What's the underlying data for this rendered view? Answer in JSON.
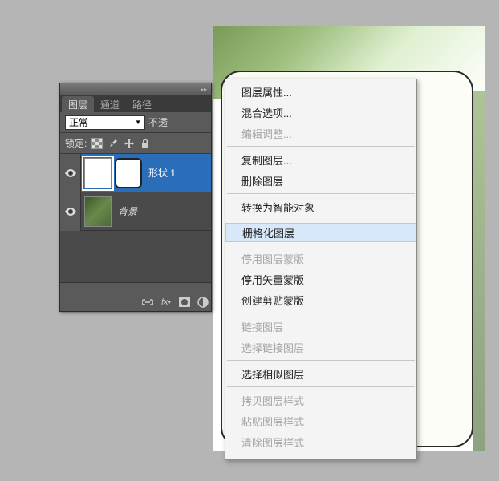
{
  "panel": {
    "tabs": {
      "layers": "图层",
      "channels": "通道",
      "paths": "路径"
    },
    "blend_mode": "正常",
    "opacity_label": "不透",
    "lock_label": "锁定:",
    "layers": [
      {
        "name": "形状 1"
      },
      {
        "name": "背景"
      }
    ]
  },
  "menu": {
    "layer_properties": "图层属性...",
    "blending_options": "混合选项...",
    "edit_adjustment": "编辑调整...",
    "duplicate_layer": "复制图层...",
    "delete_layer": "删除图层",
    "convert_smart_object": "转换为智能对象",
    "rasterize_layer": "栅格化图层",
    "disable_layer_mask": "停用图层蒙版",
    "disable_vector_mask": "停用矢量蒙版",
    "create_clipping_mask": "创建剪贴蒙版",
    "link_layers": "链接图层",
    "select_linked": "选择链接图层",
    "select_similar": "选择相似图层",
    "copy_layer_style": "拷贝图层样式",
    "paste_layer_style": "粘贴图层样式",
    "clear_layer_style": "清除图层样式"
  }
}
